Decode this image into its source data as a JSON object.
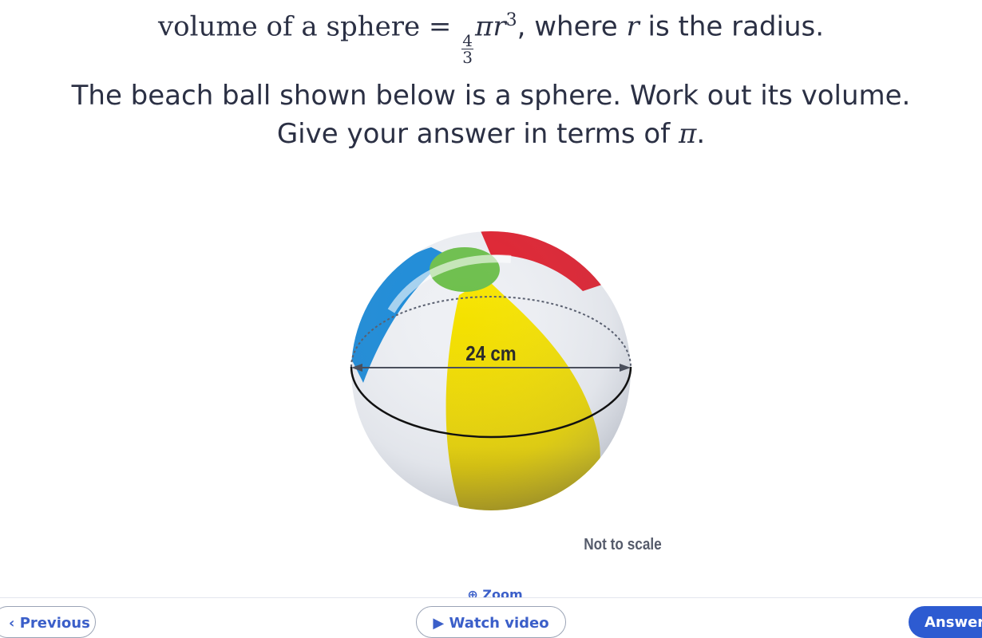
{
  "formula": {
    "prefix": "volume of a sphere",
    "equals": "=",
    "frac_num": "4",
    "frac_den": "3",
    "pi": "π",
    "var": "r",
    "exp": "3",
    "comma": ",",
    "where_text": "where",
    "var2": "r",
    "suffix": "is the radius."
  },
  "question": {
    "line1": "The beach ball shown below is a sphere. Work out its volume.",
    "line2_prefix": "Give your answer in terms of",
    "line2_pi": "π",
    "line2_end": "."
  },
  "diagram": {
    "diameter_label": "24 cm",
    "not_to_scale": "Not to scale"
  },
  "zoom_label": "Zoom",
  "footer": {
    "previous_label": "Previous",
    "watch_video_label": "Watch video",
    "answer_label": "Answer"
  },
  "colors": {
    "text": "#2b3044",
    "ball_red": "#e01f2d",
    "ball_blue": "#1a8ad8",
    "ball_yellow": "#f3e000",
    "ball_green": "#6cbf4a",
    "accent": "#2d5bd1"
  }
}
